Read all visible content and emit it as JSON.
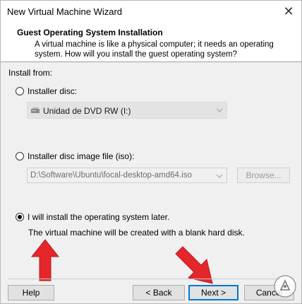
{
  "window": {
    "title": "New Virtual Machine Wizard",
    "close_glyph": "✕"
  },
  "header": {
    "title": "Guest Operating System Installation",
    "description": "A virtual machine is like a physical computer; it needs an operating system. How will you install the guest operating system?"
  },
  "install_from": {
    "label": "Install from:",
    "options": [
      {
        "label": "Installer disc:",
        "selected": false
      },
      {
        "label": "Installer disc image file (iso):",
        "selected": false
      },
      {
        "label": "I will install the operating system later.",
        "selected": true
      }
    ],
    "disc_select": {
      "value": "Unidad de DVD RW (I:)"
    },
    "iso_path": {
      "value": "D:\\Software\\Ubuntu\\focal-desktop-amd64.iso"
    },
    "browse_label": "Browse...",
    "later_description": "The virtual machine will be created with a blank hard disk."
  },
  "buttons": {
    "help": "Help",
    "back": "< Back",
    "next": "Next >",
    "cancel": "Cancel"
  },
  "colors": {
    "accent": "#0078d7",
    "arrow": "#e5262b"
  }
}
